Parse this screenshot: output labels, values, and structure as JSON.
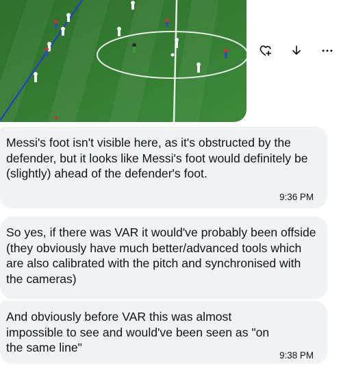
{
  "media": {
    "description_icon": "football-pitch-image"
  },
  "actions": {
    "icons": [
      "heart-plus-icon",
      "download-icon",
      "more-icon"
    ],
    "more_label": "···"
  },
  "messages": [
    {
      "text": "Messi's foot isn't visible here, as it's obstructed by the defender, but it looks like Messi's foot would definitely be (slightly) ahead of the defender's foot.",
      "time": "9:36 PM"
    },
    {
      "text": "So yes, if there was VAR it would've probably been offside (they obviously have much better/advanced tools which are also calibrated with the pitch and synchronised with the cameras)",
      "time": ""
    },
    {
      "text": "And obviously before VAR this was almost impossible to see and would've been seen as \"on the same line\"",
      "time": "9:38 PM"
    }
  ],
  "colors": {
    "bubble": "#eff3f4",
    "pitch": "#2f7a32",
    "offside_line": "#1d3fd0"
  }
}
